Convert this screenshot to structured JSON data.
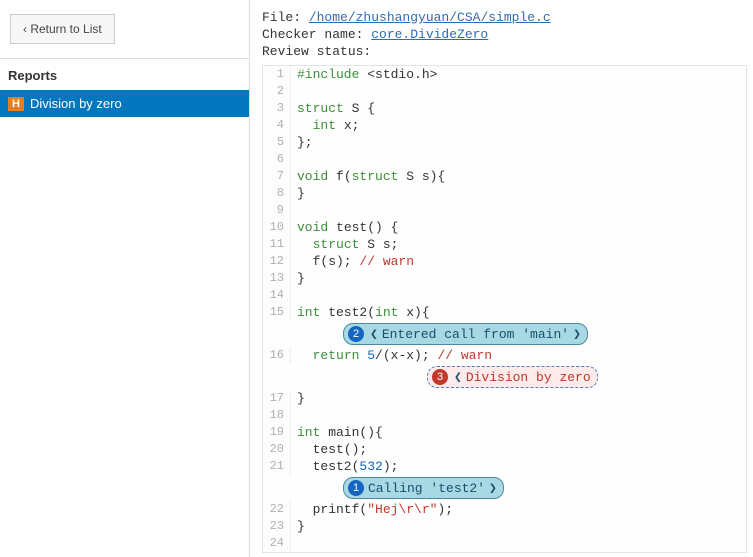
{
  "sidebar": {
    "return_label": "‹  Return to List",
    "reports_header": "Reports",
    "report_badge": "H",
    "report_label": "Division by zero"
  },
  "meta": {
    "file_label": "File: ",
    "file_path": "/home/zhushangyuan/CSA/simple.c",
    "checker_label": "Checker name: ",
    "checker_name": "core.DivideZero",
    "review_label": "Review status:",
    "review_value": ""
  },
  "code": {
    "lines": [
      {
        "n": 1,
        "html": "<span class='pp'>#include</span> &lt;stdio.h&gt;"
      },
      {
        "n": 2,
        "html": ""
      },
      {
        "n": 3,
        "html": "<span class='kw'>struct</span> S {"
      },
      {
        "n": 4,
        "html": "  <span class='kw'>int</span> x;"
      },
      {
        "n": 5,
        "html": "};"
      },
      {
        "n": 6,
        "html": ""
      },
      {
        "n": 7,
        "html": "<span class='kw'>void</span> f(<span class='kw'>struct</span> S s){"
      },
      {
        "n": 8,
        "html": "}"
      },
      {
        "n": 9,
        "html": ""
      },
      {
        "n": 10,
        "html": "<span class='kw'>void</span> test() {"
      },
      {
        "n": 11,
        "html": "  <span class='kw'>struct</span> S s;"
      },
      {
        "n": 12,
        "html": "  f(s); <span class='cmt'>// warn</span>"
      },
      {
        "n": 13,
        "html": "}"
      },
      {
        "n": 14,
        "html": ""
      },
      {
        "n": 15,
        "html": "<span class='kw'>int</span> test2(<span class='kw'>int</span> x){"
      },
      {
        "diag": true,
        "indent": 46,
        "style": "blue",
        "step": "2",
        "circle": "blue",
        "left": true,
        "right": true,
        "text": "Entered  call  from  'main'"
      },
      {
        "n": 16,
        "html": "  <span class='kw'>return</span> <span class='num'>5</span>/(x-x); <span class='cmt'>// warn</span>"
      },
      {
        "diag": true,
        "indent": 130,
        "style": "red",
        "step": "3",
        "circle": "red",
        "left": true,
        "right": false,
        "text": "Division  by  zero"
      },
      {
        "n": 17,
        "html": "}"
      },
      {
        "n": 18,
        "html": ""
      },
      {
        "n": 19,
        "html": "<span class='kw'>int</span> main(){"
      },
      {
        "n": 20,
        "html": "  test();"
      },
      {
        "n": 21,
        "html": "  test2(<span class='num'>532</span>);"
      },
      {
        "diag": true,
        "indent": 46,
        "style": "blue",
        "step": "1",
        "circle": "blue",
        "left": false,
        "right": true,
        "text": "Calling  'test2'"
      },
      {
        "n": 22,
        "html": "  printf(<span class='str'>\"Hej\\r\\r\"</span>);"
      },
      {
        "n": 23,
        "html": "}"
      },
      {
        "n": 24,
        "html": ""
      }
    ]
  }
}
